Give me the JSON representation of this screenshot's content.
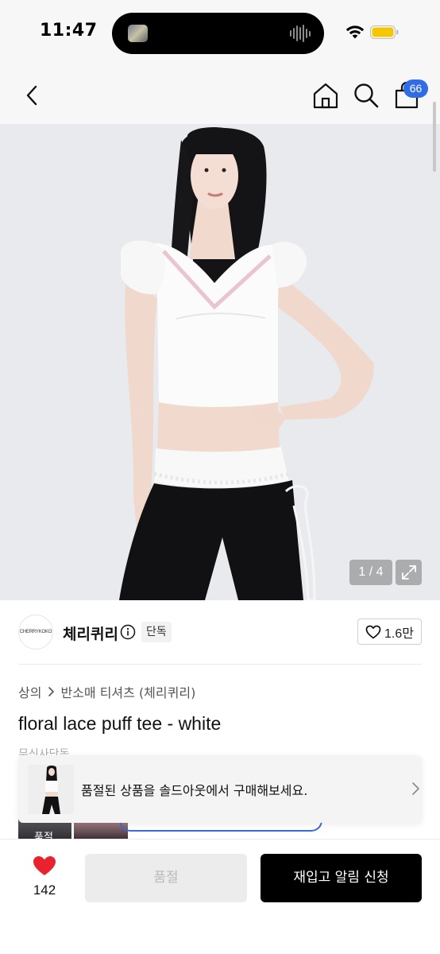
{
  "status_bar": {
    "time": "11:47"
  },
  "nav": {
    "back_icon": "chevron-left-icon",
    "home_icon": "home-icon",
    "search_icon": "search-icon",
    "cart_icon": "shopping-bag-icon",
    "cart_count": "66",
    "cart_badge_color": "#2f6ce5"
  },
  "gallery": {
    "counter": "1 / 4",
    "expand_icon": "expand-icon"
  },
  "brand": {
    "logo_text": "CHERRYKOKO",
    "name": "체리퀴리",
    "info_icon": "info-icon",
    "badge": "단독",
    "like_icon": "heart-outline-icon",
    "like_count": "1.6만"
  },
  "breadcrumb": {
    "category": "상의",
    "subcategory": "반소매 티셔츠 (체리퀴리)"
  },
  "product": {
    "title": "floral lace puff tee - white",
    "partial_tag": "무신사단독"
  },
  "thumbs": {
    "first_label": "품절"
  },
  "soldout_banner": {
    "text": "품절된 상품을 솔드아웃에서 구매해보세요.",
    "chevron_icon": "chevron-right-icon"
  },
  "bottom_bar": {
    "heart_icon": "heart-filled-icon",
    "heart_color": "#e8232f",
    "heart_count": "142",
    "soldout_label": "품절",
    "restock_label": "재입고 알림 신청"
  }
}
